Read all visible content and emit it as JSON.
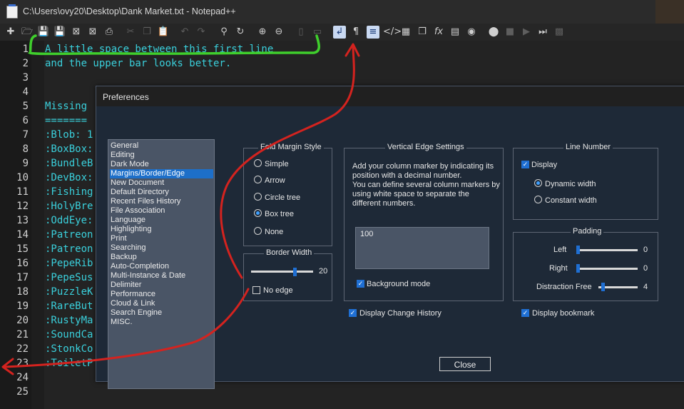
{
  "window": {
    "title": "C:\\Users\\ovy20\\Desktop\\Dank Market.txt - Notepad++"
  },
  "toolbar": {
    "icons": [
      "new-file-icon",
      "open-folder-icon",
      "save-icon",
      "save-all-icon",
      "close-icon",
      "close-all-icon",
      "print-icon",
      "cut-icon",
      "copy-icon",
      "paste-icon",
      "undo-icon",
      "redo-icon",
      "find-icon",
      "replace-icon",
      "zoom-in-icon",
      "zoom-out-icon",
      "sync-v-icon",
      "sync-h-icon",
      "word-wrap-icon",
      "show-all-chars-icon",
      "indent-guide-icon",
      "xml-tag-icon",
      "document-map-icon",
      "clone-icon",
      "function-list-icon",
      "monitor-icon",
      "screenshot-icon",
      "record-macro-icon",
      "stop-macro-icon",
      "play-macro-icon",
      "run-macro-multiple-icon",
      "save-macro-icon"
    ]
  },
  "editor": {
    "line_numbers": [
      "1",
      "2",
      "3",
      "4",
      "5",
      "6",
      "7",
      "8",
      "9",
      "10",
      "11",
      "12",
      "13",
      "14",
      "15",
      "16",
      "17",
      "18",
      "19",
      "20",
      "21",
      "22",
      "23",
      "24",
      "25"
    ],
    "lines": [
      "A little space between this first line",
      "and the upper bar looks better.",
      "",
      "",
      "Missing",
      "=======",
      ":Blob: 1",
      ":BoxBox:",
      ":BundleB",
      ":DevBox:",
      ":Fishing",
      ":HolyBre",
      ":OddEye:",
      ":Patreon",
      ":Patreon",
      ":PepeRib",
      ":PepeSus",
      ":PuzzleK",
      ":RareBut",
      ":RustyMa",
      ":SoundCa",
      ":StonkCo",
      ":ToiletP",
      "",
      ""
    ]
  },
  "preferences": {
    "title": "Preferences",
    "categories": [
      "General",
      "Editing",
      "Dark Mode",
      "Margins/Border/Edge",
      "New Document",
      "Default Directory",
      "Recent Files History",
      "File Association",
      "Language",
      "Highlighting",
      "Print",
      "Searching",
      "Backup",
      "Auto-Completion",
      "Multi-Instance & Date",
      "Delimiter",
      "Performance",
      "Cloud & Link",
      "Search Engine",
      "MISC."
    ],
    "selected_category": "Margins/Border/Edge",
    "fold_margin": {
      "title": "Fold Margin Style",
      "options": [
        "Simple",
        "Arrow",
        "Circle tree",
        "Box tree",
        "None"
      ],
      "selected": "Box tree"
    },
    "border_width": {
      "title": "Border Width",
      "value": "20",
      "level": 0.72,
      "no_edge_label": "No edge",
      "no_edge_checked": false
    },
    "vertical_edge": {
      "title": "Vertical Edge Settings",
      "description_1": "Add your column marker by indicating its",
      "description_2": "position with a decimal number.",
      "description_3": "You can define several column markers by",
      "description_4": "using white space to separate the",
      "description_5": "different numbers.",
      "value": "100",
      "background_mode_label": "Background mode",
      "background_mode_checked": true
    },
    "line_number": {
      "title": "Line Number",
      "display_label": "Display",
      "display_checked": true,
      "options": [
        "Dynamic width",
        "Constant width"
      ],
      "selected": "Dynamic width"
    },
    "padding": {
      "title": "Padding",
      "left_label": "Left",
      "left_value": "0",
      "left_level": 0,
      "right_label": "Right",
      "right_value": "0",
      "right_level": 0,
      "distraction_label": "Distraction Free",
      "distraction_value": "4",
      "distraction_level": 0.07
    },
    "display_change_history_label": "Display Change History",
    "display_change_history_checked": true,
    "display_bookmark_label": "Display bookmark",
    "display_bookmark_checked": true,
    "close_label": "Close"
  },
  "annotations": {
    "green_bracket_color": "#3fcf2c",
    "red_arrow_color": "#d4231f"
  }
}
